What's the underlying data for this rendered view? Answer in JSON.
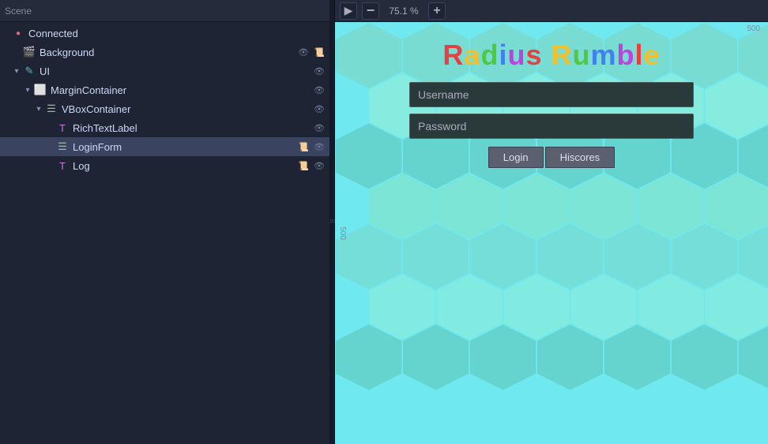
{
  "tree": {
    "items": [
      {
        "id": "connected",
        "label": "Connected",
        "icon": "circle",
        "indent": 0,
        "expanded": true,
        "hasArrow": false,
        "actions": []
      },
      {
        "id": "background",
        "label": "Background",
        "icon": "scene",
        "indent": 1,
        "expanded": false,
        "hasArrow": false,
        "actions": [
          "eye",
          "script"
        ]
      },
      {
        "id": "ui",
        "label": "UI",
        "icon": "ui",
        "indent": 1,
        "expanded": true,
        "hasArrow": true,
        "actions": [
          "eye"
        ]
      },
      {
        "id": "margincontainer",
        "label": "MarginContainer",
        "icon": "margin",
        "indent": 2,
        "expanded": true,
        "hasArrow": true,
        "actions": [
          "eye"
        ]
      },
      {
        "id": "vboxcontainer",
        "label": "VBoxContainer",
        "icon": "vbox",
        "indent": 3,
        "expanded": true,
        "hasArrow": true,
        "actions": [
          "eye"
        ]
      },
      {
        "id": "richtextlabel",
        "label": "RichTextLabel",
        "icon": "label",
        "indent": 4,
        "expanded": false,
        "hasArrow": false,
        "actions": [
          "eye"
        ]
      },
      {
        "id": "loginform",
        "label": "LoginForm",
        "icon": "form",
        "indent": 4,
        "expanded": false,
        "hasArrow": false,
        "selected": true,
        "actions": [
          "script",
          "eye"
        ]
      },
      {
        "id": "log",
        "label": "Log",
        "icon": "log",
        "indent": 4,
        "expanded": false,
        "hasArrow": false,
        "actions": [
          "script",
          "eye"
        ]
      }
    ]
  },
  "preview": {
    "zoom": "75.1 %",
    "game_title_r": "R",
    "game_title_a": "a",
    "game_title_d": "d",
    "game_title_iu": "iu",
    "game_title_s": "s",
    "game_title_space": " ",
    "game_title_ru": "Ru",
    "game_title_m": "m",
    "game_title_ble": "ble",
    "game_title_full": "Radius Rumble",
    "username_placeholder": "Username",
    "password_placeholder": "Password",
    "login_btn": "Login",
    "hiscores_btn": "Hiscores",
    "ruler_500": "500"
  },
  "colors": {
    "bg_sky": "#70e8f0",
    "hex_light": "#90eed8",
    "hex_med": "#7adace",
    "hex_dark": "#60c8b8",
    "title_r": "#e84040",
    "title_a": "#f0c030",
    "title_d": "#50c840",
    "title_i": "#4080f0",
    "title_u": "#c040e0",
    "title_s": "#e84040",
    "title_space": "#ffffff",
    "title_R2": "#f0c030",
    "title_u2": "#50c840",
    "title_m": "#4080f0",
    "title_b": "#c040e0",
    "title_l": "#e84040",
    "title_e": "#f0c030"
  }
}
